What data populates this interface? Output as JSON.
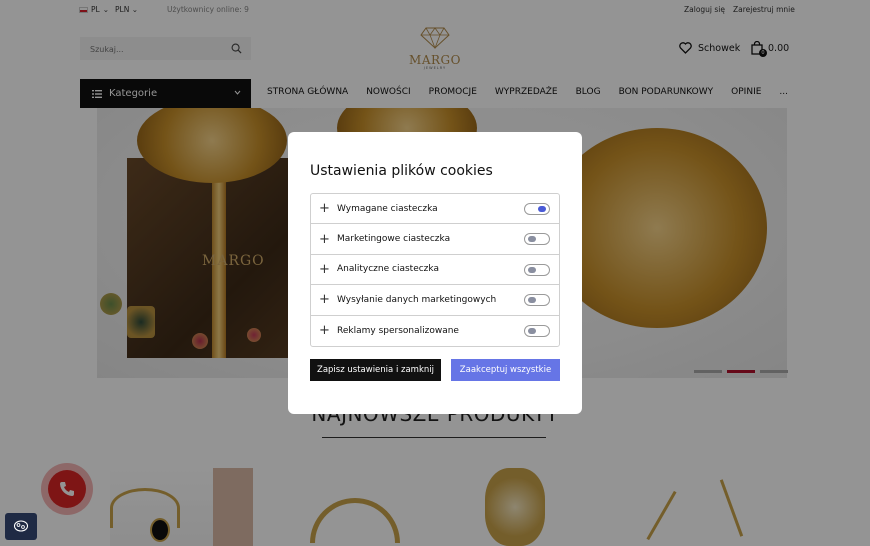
{
  "topbar": {
    "language": "PL",
    "currency": "PLN",
    "online_users": "Użytkownicy online: 9",
    "login": "Zaloguj się",
    "register": "Zarejestruj mnie"
  },
  "header": {
    "search_placeholder": "Szukaj...",
    "logo_text": "MARGO",
    "logo_sub": "JEWELRY",
    "wishlist_label": "Schowek",
    "cart_count": "0",
    "cart_total": "0.00"
  },
  "nav": {
    "categories_label": "Kategorie",
    "items": [
      "STRONA GŁÓWNA",
      "NOWOŚCI",
      "PROMOCJE",
      "WYPRZEDAŻE",
      "BLOG",
      "BON PODARUNKOWY",
      "OPINIE",
      "..."
    ]
  },
  "hero": {
    "box_logo": "MARGO",
    "active_slide": 2,
    "slides": 3
  },
  "section": {
    "title": "NAJNOWSZE PRODUKTY"
  },
  "cookie_modal": {
    "title": "Ustawienia plików cookies",
    "options": [
      {
        "label": "Wymagane ciasteczka",
        "enabled": true
      },
      {
        "label": "Marketingowe ciasteczka",
        "enabled": false
      },
      {
        "label": "Analityczne ciasteczka",
        "enabled": false
      },
      {
        "label": "Wysyłanie danych marketingowych",
        "enabled": false
      },
      {
        "label": "Reklamy spersonalizowane",
        "enabled": false
      }
    ],
    "save_button": "Zapisz ustawienia i zamknij",
    "accept_button": "Zaakceptuj wszystkie"
  },
  "colors": {
    "accent": "#6675e6",
    "dark": "#111111",
    "brand_gold": "#b08a4a",
    "phone_red": "#d92525"
  }
}
